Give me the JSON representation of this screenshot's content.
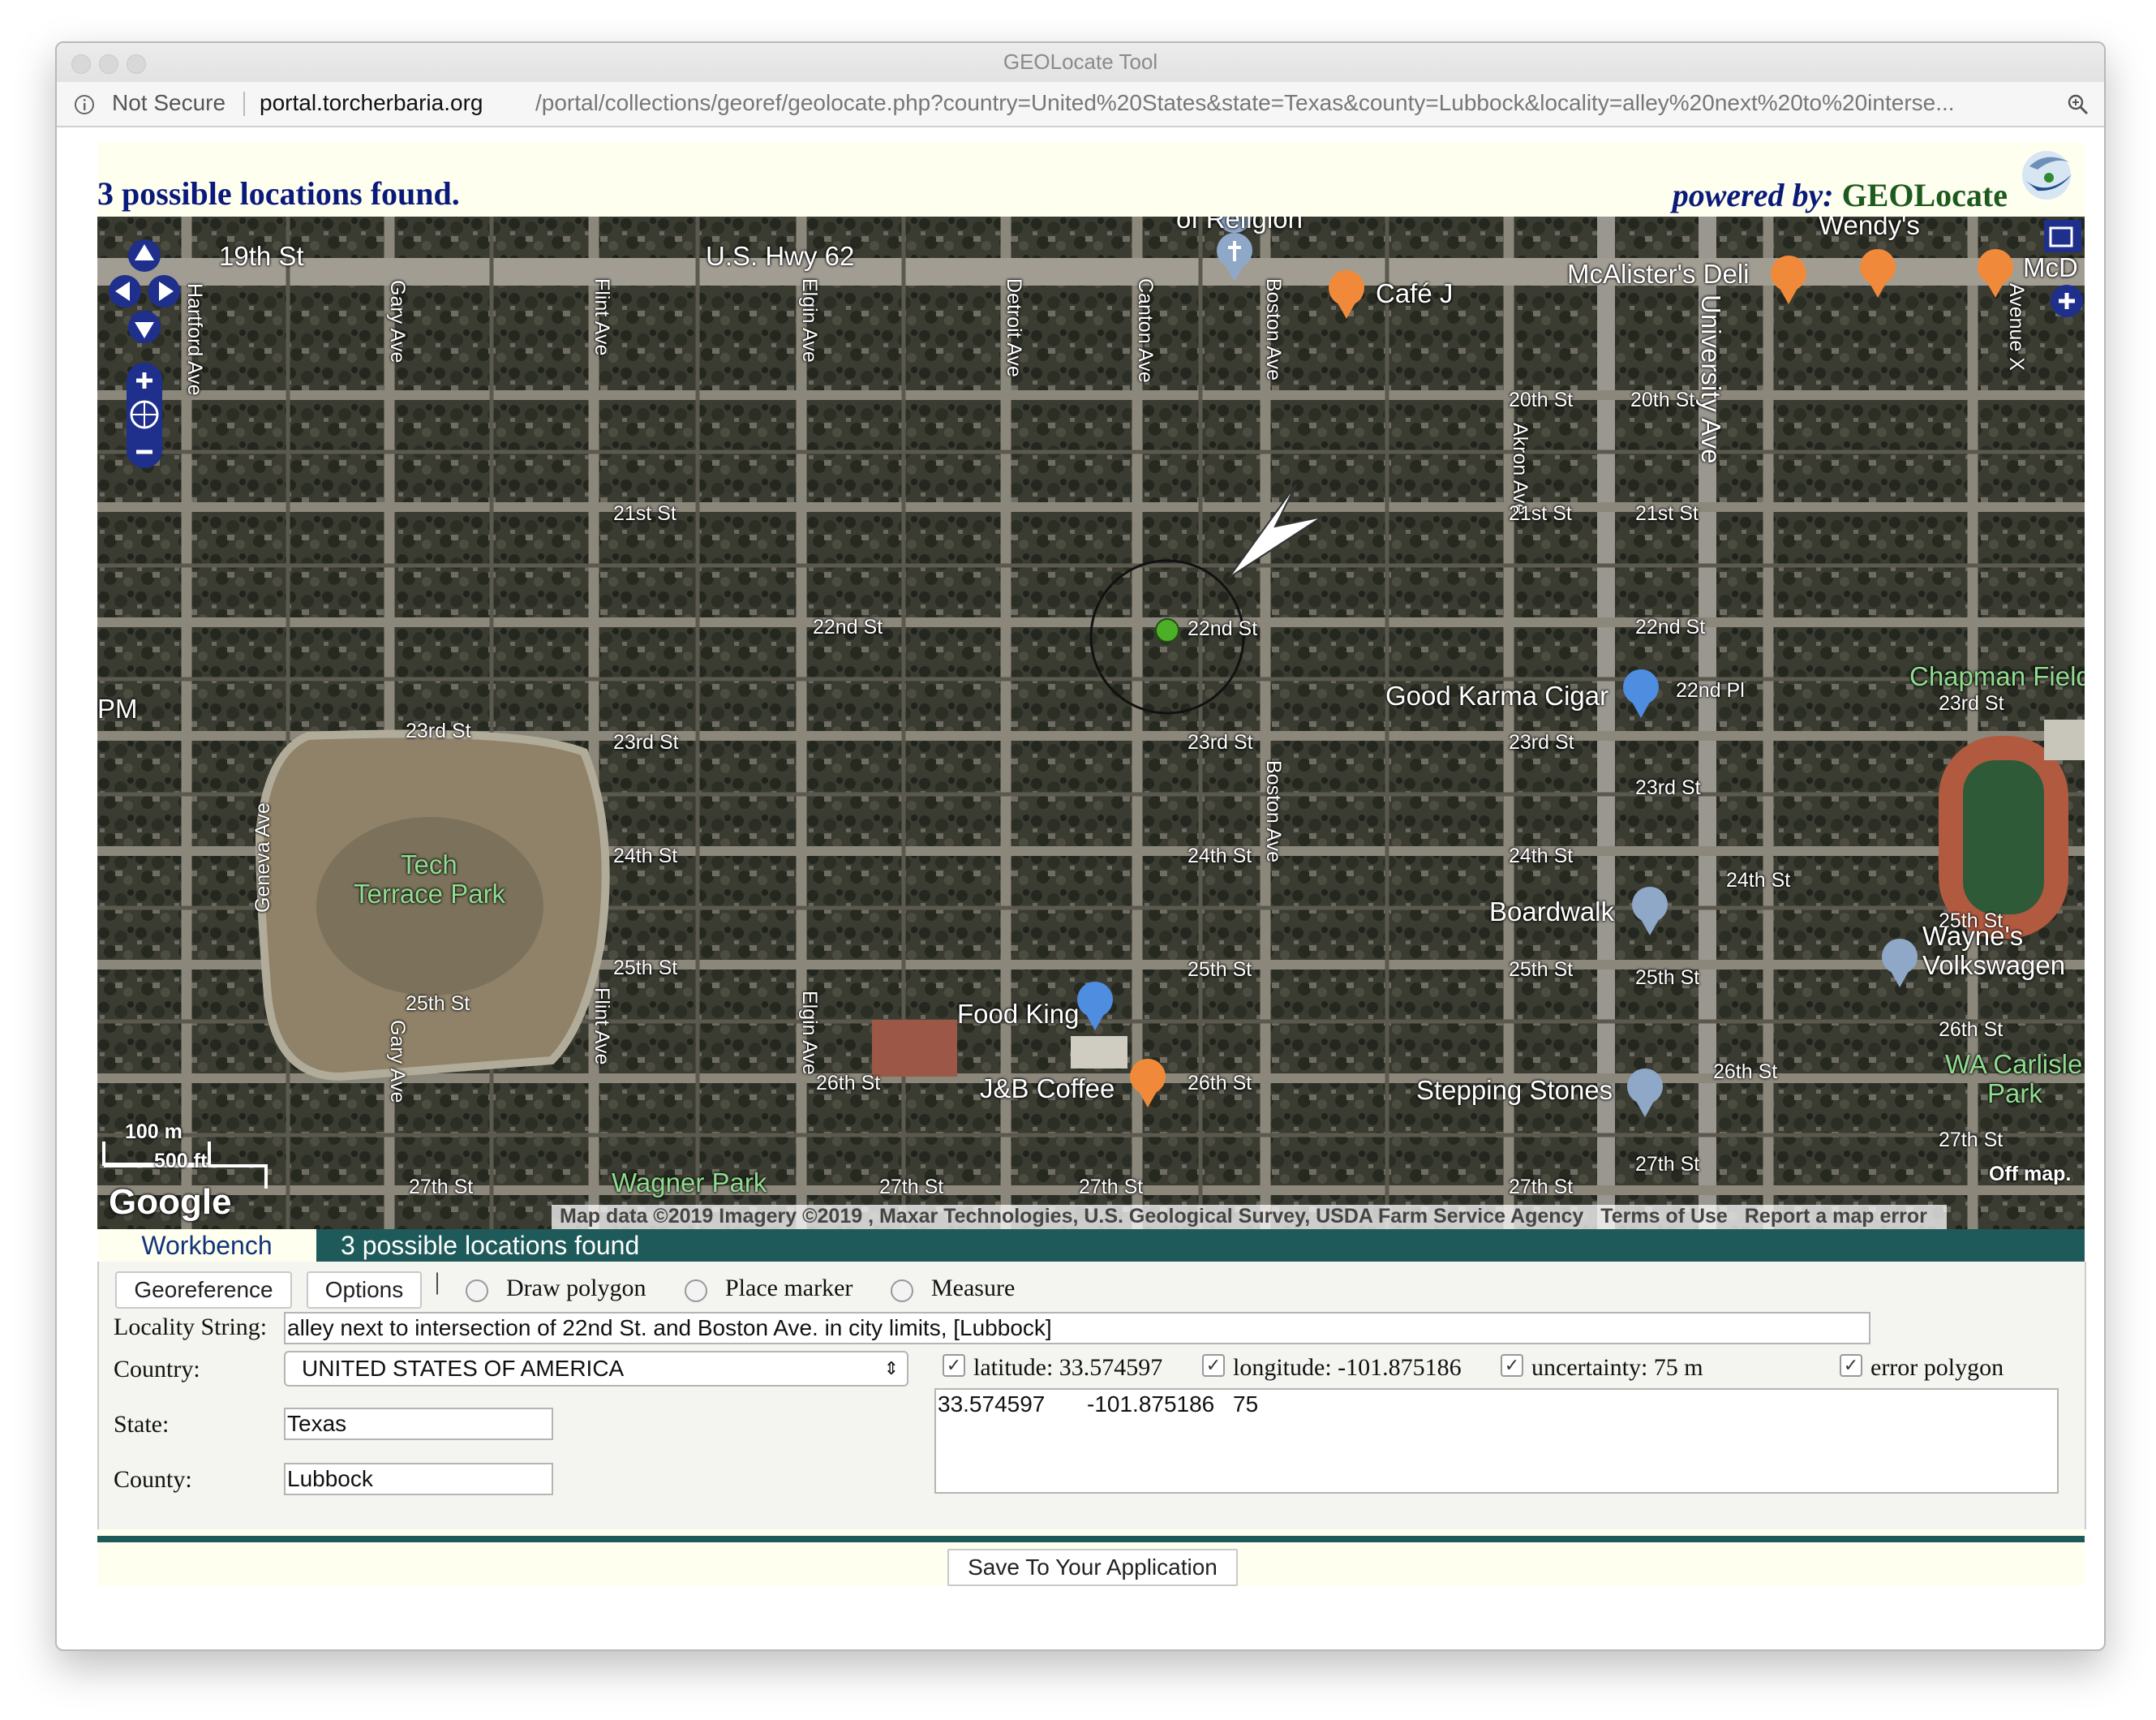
{
  "window": {
    "title": "GEOLocate Tool",
    "security": "Not Secure",
    "url_host": "portal.torcherbaria.org",
    "url_path": "/portal/collections/georef/geolocate.php?country=United%20States&state=Texas&county=Lubbock&locality=alley%20next%20to%20interse..."
  },
  "header": {
    "found_text": "3 possible locations found.",
    "powered_label": "powered by:",
    "powered_brand": "GEOLocate"
  },
  "map": {
    "streets": {
      "st19": "19th St",
      "hwy62": "U.S. Hwy 62",
      "hartford": "Hartford Ave",
      "gary": "Gary Ave",
      "flint": "Flint Ave",
      "elgin": "Elgin Ave",
      "detroit": "Detroit Ave",
      "canton": "Canton Ave",
      "boston": "Boston Ave",
      "university": "University Ave",
      "akron": "Akron Ave",
      "avex": "Avenue X",
      "st20a": "20th St",
      "st20b": "20th St",
      "st21a": "21st St",
      "st21b": "21st St",
      "st21c": "21st St",
      "st22a": "22nd St",
      "st22b": "22nd St",
      "st22c": "22nd St",
      "pl22": "22nd Pl",
      "st23a": "23rd St",
      "st23b": "23rd St",
      "st23c": "23rd St",
      "st23d": "23rd St",
      "st23e": "23rd St",
      "st23f": "23rd St",
      "st24a": "24th St",
      "st24b": "24th St",
      "st24c": "24th St",
      "st24d": "24th St",
      "st25a": "25th St",
      "st25b": "25th St",
      "st25c": "25th St",
      "st25d": "25th St",
      "st25e": "25th St",
      "st25f": "25th St",
      "st26a": "26th St",
      "st26b": "26th St",
      "st26c": "26th St",
      "st26d": "26th St",
      "st27a": "27th St",
      "st27b": "27th St",
      "st27c": "27th St",
      "st27d": "27th St",
      "st27e": "27th St",
      "st27f": "27th St",
      "geneva": "Geneva Ave",
      "gary2": "Gary Ave",
      "flint2": "Flint Ave",
      "elgin2": "Elgin Ave",
      "boston2": "Boston Ave"
    },
    "places": {
      "religion": "of Religion",
      "cafe_j": "Café J",
      "mcalisters": "McAlister's Deli",
      "wendys": "Wendy's",
      "mcd": "McD",
      "good_karma": "Good Karma Cigar",
      "chapman": "Chapman Field",
      "tech_terrace_1": "Tech",
      "tech_terrace_2": "Terrace Park",
      "boardwalk": "Boardwalk",
      "waynes_1": "Wayne's",
      "waynes_2": "Volkswagen",
      "food_king": "Food King",
      "jb_coffee": "J&B Coffee",
      "stepping_stones": "Stepping Stones",
      "wagner": "Wagner Park",
      "wa_carlisle_1": "WA Carlisle",
      "wa_carlisle_2": "Park",
      "pm": "PM"
    },
    "scale_m": "100 m",
    "scale_ft": "500 ft",
    "google": "Google",
    "off_map": "Off map.",
    "attribution": "Map data ©2019 Imagery ©2019 , Maxar Technologies, U.S. Geological Survey, USDA Farm Service Agency",
    "terms": "Terms of Use",
    "report": "Report a map error"
  },
  "workbench": {
    "tab_active": "Workbench",
    "tab_info": "3 possible locations found",
    "georeference_btn": "Georeference",
    "options_btn": "Options",
    "separator": "|",
    "draw_polygon": "Draw polygon",
    "place_marker": "Place marker",
    "measure": "Measure",
    "locality_label": "Locality String:",
    "locality_value": "alley next to intersection of 22nd St. and Boston Ave. in city limits, [Lubbock]",
    "country_label": "Country:",
    "country_value": "UNITED STATES OF AMERICA",
    "state_label": "State:",
    "state_value": "Texas",
    "county_label": "County:",
    "county_value": "Lubbock",
    "latitude_label": "latitude: 33.574597",
    "longitude_label": "longitude: -101.875186",
    "uncertainty_label": "uncertainty: 75 m",
    "error_polygon_label": "error polygon",
    "result_lat": "33.574597",
    "result_lon": "-101.875186",
    "result_unc": "75",
    "save_btn": "Save To Your Application"
  }
}
